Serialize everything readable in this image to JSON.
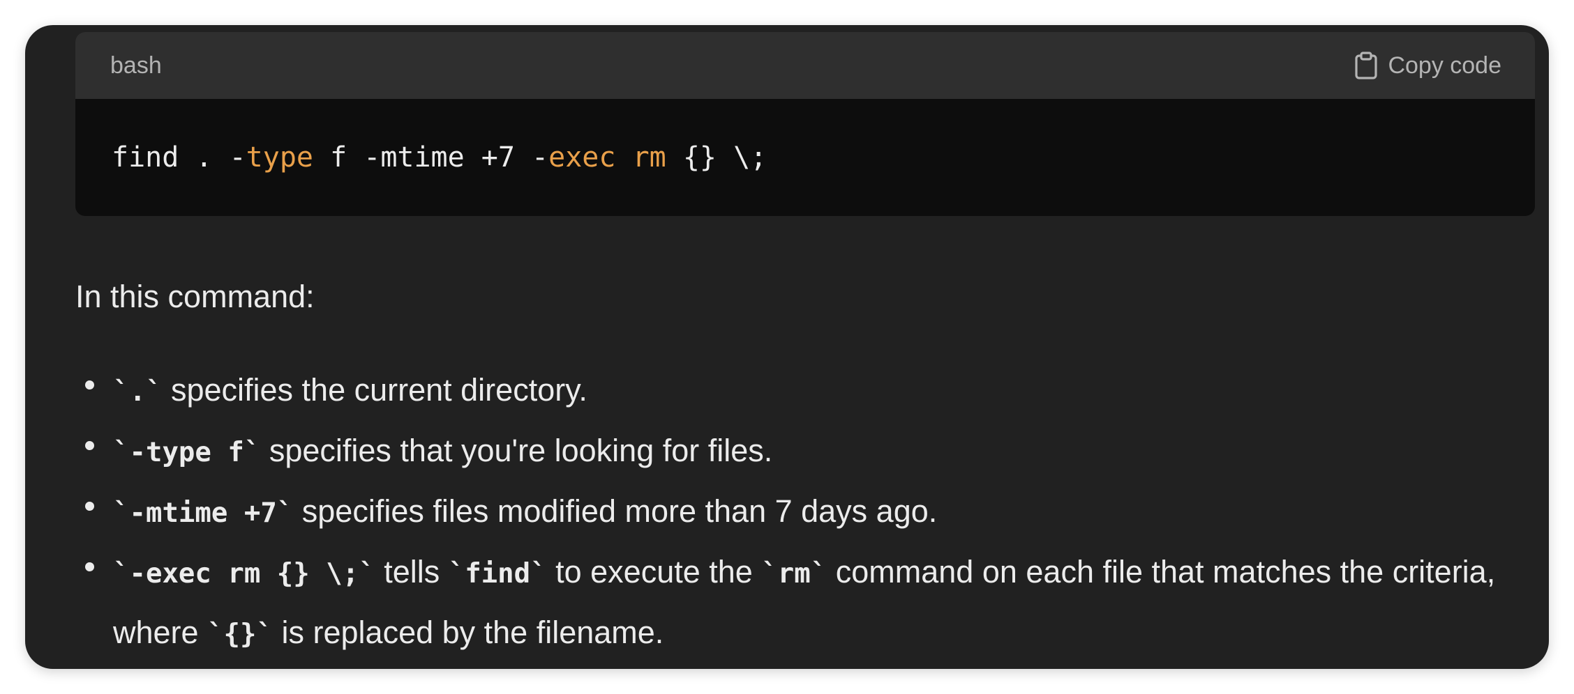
{
  "code_block": {
    "language": "bash",
    "copy_label": "Copy code",
    "tokens": [
      {
        "text": "find . -",
        "kind": "plain"
      },
      {
        "text": "type",
        "kind": "kw"
      },
      {
        "text": " f -mtime +7 -",
        "kind": "plain"
      },
      {
        "text": "exec",
        "kind": "kw"
      },
      {
        "text": " ",
        "kind": "plain"
      },
      {
        "text": "rm",
        "kind": "kw"
      },
      {
        "text": " {} \\;",
        "kind": "plain"
      }
    ]
  },
  "explanation": {
    "intro": "In this command:",
    "items": [
      {
        "parts": [
          {
            "code": "`.`"
          },
          {
            "text": " specifies the current directory."
          }
        ]
      },
      {
        "parts": [
          {
            "code": "`-type f`"
          },
          {
            "text": " specifies that you're looking for files."
          }
        ]
      },
      {
        "parts": [
          {
            "code": "`-mtime +7`"
          },
          {
            "text": " specifies files modified more than 7 days ago."
          }
        ]
      },
      {
        "parts": [
          {
            "code": "`-exec rm {} \\;`"
          },
          {
            "text": " tells "
          },
          {
            "code": "`find`"
          },
          {
            "text": " to execute the "
          },
          {
            "code": "`rm`"
          },
          {
            "text": " command on each file that matches the criteria, where "
          },
          {
            "code": "`{}`"
          },
          {
            "text": " is replaced by the filename."
          }
        ]
      }
    ]
  },
  "colors": {
    "background": "#212121",
    "code_background": "#0d0d0d",
    "code_header": "#2f2f2f",
    "keyword": "#e9a04a",
    "text": "#ececec",
    "muted": "#b4b4b4"
  },
  "icons": {
    "copy": "clipboard-icon"
  }
}
